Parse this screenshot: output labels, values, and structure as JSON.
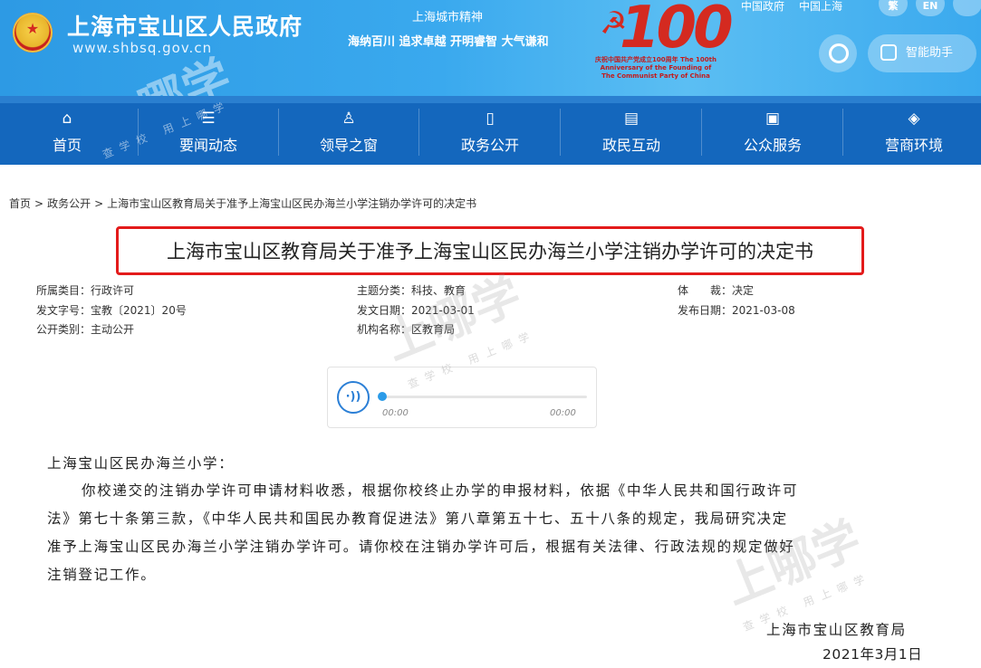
{
  "header": {
    "site_name": "上海市宝山区人民政府",
    "site_url": "www.shbsq.gov.cn",
    "spirit_title": "上海城市精神",
    "spirit_text": "海纳百川 追求卓越 开明睿智 大气谦和",
    "anniversary_number": "100",
    "anniversary_caption": "庆祝中国共产党成立100周年 The 100th Anniversary of the Founding of The Communist Party of China",
    "top_links": [
      "中国政府",
      "中国上海"
    ],
    "lang_buttons": [
      "繁",
      "EN"
    ],
    "assistant_label": "智能助手"
  },
  "nav": {
    "items": [
      {
        "label": "首页",
        "icon": "⌂"
      },
      {
        "label": "要闻动态",
        "icon": "☰"
      },
      {
        "label": "领导之窗",
        "icon": "♙"
      },
      {
        "label": "政务公开",
        "icon": "▯"
      },
      {
        "label": "政民互动",
        "icon": "▤"
      },
      {
        "label": "公众服务",
        "icon": "▣"
      },
      {
        "label": "营商环境",
        "icon": "◈"
      }
    ]
  },
  "breadcrumb": {
    "home": "首页",
    "section": "政务公开",
    "current": "上海市宝山区教育局关于准予上海宝山区民办海兰小学注销办学许可的决定书",
    "sep": ">"
  },
  "doc": {
    "title": "上海市宝山区教育局关于准予上海宝山区民办海兰小学注销办学许可的决定书",
    "meta": {
      "category_label": "所属类目：",
      "category": "行政许可",
      "doc_no_label": "发文字号：",
      "doc_no": "宝教〔2021〕20号",
      "publicity_label": "公开类别：",
      "publicity": "主动公开",
      "topic_label": "主题分类：",
      "topic": "科技、教育",
      "issue_date_label": "发文日期：",
      "issue_date": "2021-03-01",
      "org_label": "机构名称：",
      "org": "区教育局",
      "genre_label": "体　　裁：",
      "genre": "决定",
      "publish_date_label": "发布日期：",
      "publish_date": "2021-03-08"
    }
  },
  "audio": {
    "play_icon": "·))",
    "time_current": "00:00",
    "time_total": "00:00",
    "progress": 0
  },
  "letter": {
    "salutation": "上海宝山区民办海兰小学：",
    "line1": "你校递交的注销办学许可申请材料收悉，根据你校终止办学的申报材料，依据《中华人民共和国行政许可",
    "line2": "法》第七十条第三款，《中华人民共和国民办教育促进法》第八章第五十七、五十八条的规定，我局研究决定",
    "line3": "准予上海宝山区民办海兰小学注销办学许可。请你校在注销办学许可后，根据有关法律、行政法规的规定做好",
    "line4": "注销登记工作。",
    "signature": "上海市宝山区教育局",
    "date": "2021年3月1日"
  },
  "watermark": {
    "brand": "上哪学",
    "tagline": "查学校 用上哪学"
  }
}
